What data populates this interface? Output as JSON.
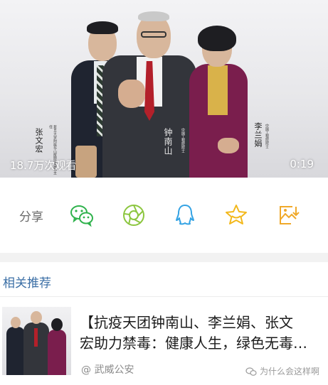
{
  "video": {
    "view_count": "18.7万次观看",
    "duration": "0:19",
    "signatures": [
      "张文宏",
      "钟南山",
      "李兰娟"
    ],
    "captions": [
      "复旦大学附属华山医院感染科主任",
      "中国工程院院士",
      "中国工程院院士"
    ]
  },
  "share": {
    "label": "分享",
    "buttons": [
      {
        "name": "wechat",
        "color": "#2fb24c"
      },
      {
        "name": "moments",
        "color": "#8cc63f"
      },
      {
        "name": "qq",
        "color": "#34a3e4"
      },
      {
        "name": "favorite",
        "color": "#f3b81b"
      },
      {
        "name": "save-image",
        "color": "#f0a92a"
      }
    ]
  },
  "related": {
    "title": "相关推荐",
    "items": [
      {
        "title_line1": "【抗疫天团钟南山、李兰娟、张文",
        "title_line2": "宏助力禁毒：健康人生，绿色无毒…",
        "source": "@ 武威公安"
      }
    ]
  },
  "watermark": {
    "text": "为什么会这样啊"
  },
  "colors": {
    "accent_link": "#3a6ea5",
    "background": "#ffffff",
    "band": "#f2f2f2"
  }
}
